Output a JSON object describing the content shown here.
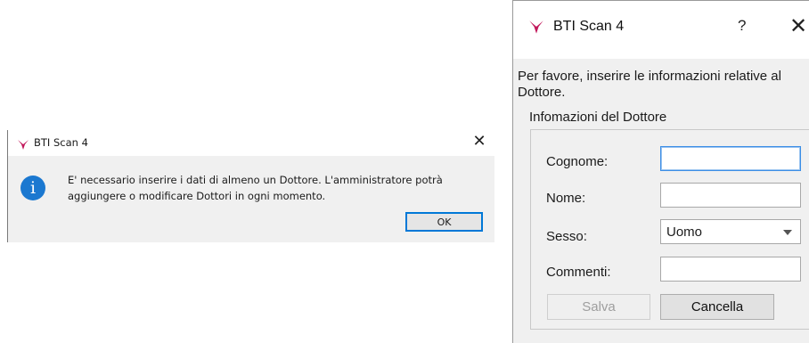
{
  "message_box": {
    "title": "BTI Scan 4",
    "close_glyph": "✕",
    "icon": "info-icon",
    "icon_glyph": "i",
    "message_line1": "E' necessario inserire i dati di almeno un Dottore. L'amministratore potrà",
    "message_line2": "aggiungere o modificare Dottori in ogni momento.",
    "ok_label": "OK"
  },
  "dialog": {
    "title": "BTI Scan 4",
    "help_glyph": "?",
    "close_glyph": "✕",
    "intro_line1": "Per favore, inserire le informazioni relative al",
    "intro_line2": "Dottore.",
    "group_title": "Infomazioni del Dottore",
    "fields": {
      "cognome": {
        "label": "Cognome:",
        "value": ""
      },
      "nome": {
        "label": "Nome:",
        "value": ""
      },
      "sesso": {
        "label": "Sesso:",
        "value": "Uomo"
      },
      "commenti": {
        "label": "Commenti:",
        "value": ""
      }
    },
    "save_label": "Salva",
    "cancel_label": "Cancella"
  },
  "colors": {
    "logo_magenta": "#c2185b",
    "info_blue": "#1b78d0",
    "focus_blue": "#3c8ee6",
    "dialog_bg": "#f0f0f0"
  }
}
